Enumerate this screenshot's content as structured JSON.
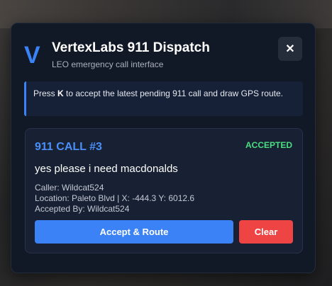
{
  "header": {
    "logo": "V",
    "title": "VertexLabs 911 Dispatch",
    "subtitle": "LEO emergency call interface",
    "close_label": "✕"
  },
  "hint": {
    "prefix": "Press ",
    "key": "K",
    "suffix": " to accept the latest pending 911 call and draw GPS route."
  },
  "call": {
    "title": "911 CALL #3",
    "status": "ACCEPTED",
    "message": "yes please i need macdonalds",
    "caller": "Caller: Wildcat524",
    "location": "Location: Paleto Blvd | X: -444.3 Y: 6012.6",
    "accepted_by": "Accepted By: Wildcat524"
  },
  "actions": {
    "accept_label": "Accept & Route",
    "clear_label": "Clear"
  },
  "colors": {
    "accent": "#3b82f6",
    "status_accepted": "#4ade80",
    "danger": "#ef4444",
    "panel": "#111826"
  }
}
